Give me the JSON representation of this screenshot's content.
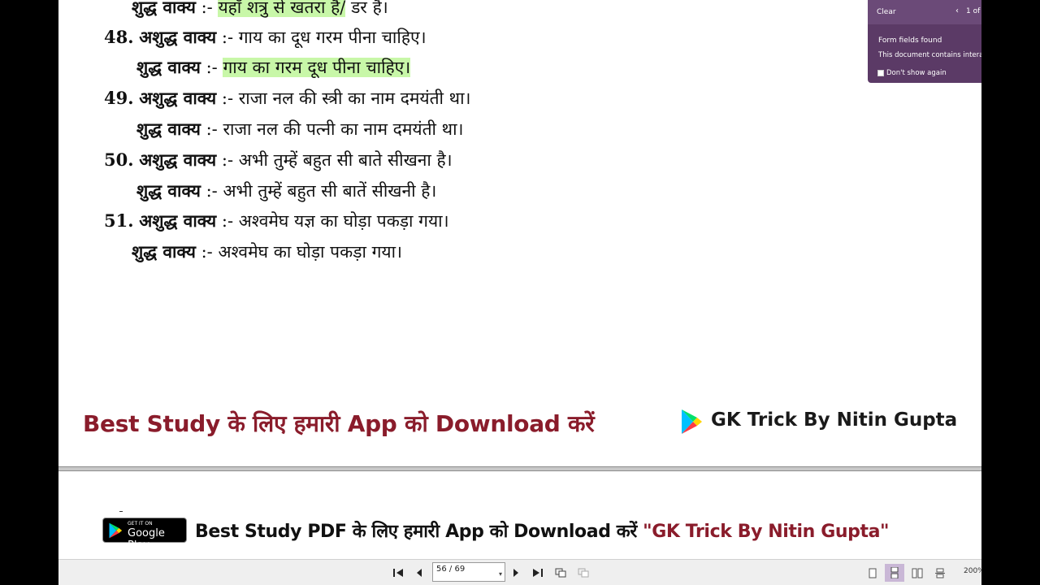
{
  "document": {
    "lines": [
      {
        "num": "",
        "label": "शुद्ध वाक्य",
        "sep": " :- ",
        "text": "यहाँ शत्रु से खतरा है/ डर है।",
        "highlight": true,
        "highlight_part": "यहाँ शत्रु से खतरा है/",
        "rest": " डर है।"
      },
      {
        "num": "48.",
        "label": "अशुद्ध वाक्य",
        "sep": " :- ",
        "text": "गाय का दूध गरम पीना चाहिए।"
      },
      {
        "num": "",
        "label": "शुद्ध वाक्य",
        "sep": " :- ",
        "text": "गाय का गरम दूध पीना चाहिए।",
        "highlight": true
      },
      {
        "num": "49.",
        "label": "अशुद्ध वाक्य",
        "sep": " :- ",
        "text": "राजा नल की स्त्री का नाम दमयंती था।"
      },
      {
        "num": "",
        "label": "शुद्ध वाक्य",
        "sep": " :- ",
        "text": "राजा नल की पत्नी का नाम दमयंती था।"
      },
      {
        "num": "50.",
        "label": "अशुद्ध वाक्य",
        "sep": " :- ",
        "text": "अभी तुम्हें बहुत सी बाते सीखना है।"
      },
      {
        "num": "",
        "label": "शुद्ध वाक्य",
        "sep": " :- ",
        "text": "अभी तुम्हें बहुत सी बातें सीखनी है।"
      },
      {
        "num": "51.",
        "label": "अशुद्ध वाक्य",
        "sep": " :- ",
        "text": "अश्वमेघ यज्ञ का घोड़ा पकड़ा गया।"
      },
      {
        "num": "",
        "label": "शुद्ध वाक्य",
        "sep": " :- ",
        "text": "अश्वमेघ का घोड़ा पकड़ा गया।"
      }
    ],
    "promo_banner": {
      "text": "Best Study के लिए हमारी App को Download करें",
      "brand": "GK Trick By Nitin Gupta"
    },
    "footer_promo": {
      "badge_small": "GET IT ON",
      "badge_big": "Google Play",
      "text": "Best Study PDF के लिए हमारी App को Download करें ",
      "brand": "\"GK Trick By Nitin Gupta\""
    }
  },
  "toolbar": {
    "page_indicator": "56 / 69",
    "zoom": "200%"
  },
  "form_panel": {
    "clear_label": "Clear",
    "count": "1 of",
    "title": "Form fields found",
    "message": "This document contains intera",
    "dont_show": "Don't show again"
  },
  "colors": {
    "highlight": "#c8f7a8",
    "promo_red": "#8a1c2b",
    "panel_purple": "#5b3a66",
    "active_view": "#c9b7d6"
  }
}
